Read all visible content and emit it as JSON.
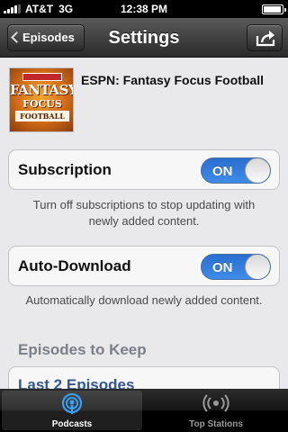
{
  "status_bar": {
    "carrier": "AT&T",
    "network": "3G",
    "time": "12:38 PM",
    "battery_level": 0.95
  },
  "nav": {
    "back_label": "Episodes",
    "title": "Settings",
    "share_icon": "share-icon"
  },
  "podcast": {
    "title": "ESPN: Fantasy Focus Football",
    "artwork": {
      "line1": "FANTASY",
      "line2": "FOCUS",
      "line3": "FOOTBALL"
    }
  },
  "subscription": {
    "label": "Subscription",
    "toggle": "ON",
    "footnote": "Turn off subscriptions to stop updating with newly added content."
  },
  "auto_download": {
    "label": "Auto-Download",
    "toggle": "ON",
    "footnote": "Automatically download newly added content."
  },
  "episodes_to_keep": {
    "header": "Episodes to Keep",
    "selected": "Last 2 Episodes"
  },
  "tab_bar": {
    "tabs": [
      {
        "label": "Podcasts",
        "icon": "podcasts-icon",
        "active": true
      },
      {
        "label": "Top Stations",
        "icon": "top-stations-icon",
        "active": false
      }
    ]
  },
  "colors": {
    "toggle_on": "#2a6fd0",
    "link_blue": "#35568e",
    "background": "#e9e9eb"
  }
}
